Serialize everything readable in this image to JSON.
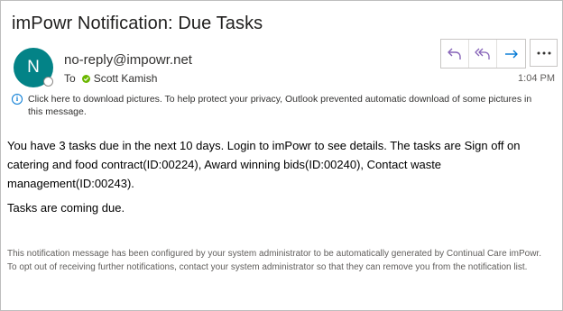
{
  "email": {
    "subject": "imPowr Notification: Due Tasks",
    "avatar_initial": "N",
    "sender": "no-reply@impowr.net",
    "to_label": "To",
    "recipient": "Scott Kamish",
    "time": "1:04 PM",
    "info_bar": "Click here to download pictures. To help protect your privacy, Outlook prevented automatic download of some pictures in this message.",
    "body_paragraph": "You have 3 tasks due in the next 10 days. Login to imPowr to see details. The tasks are Sign off on catering and food contract(ID:00224), Award winning bids(ID:00240), Contact waste management(ID:00243).",
    "body_note": "Tasks are coming due.",
    "footer_line1": "This notification message has been configured by your system administrator to be automatically generated by Continual Care imPowr.",
    "footer_line2": "To opt out of receiving further notifications, contact your system administrator so that they can remove you from the notification list."
  },
  "actions": [
    {
      "icon": "reply-icon"
    },
    {
      "icon": "reply-all-icon"
    },
    {
      "icon": "forward-icon"
    },
    {
      "icon": "more-actions-icon"
    }
  ],
  "colors": {
    "avatar": "#038387",
    "accent_purple": "#8764b8",
    "accent_blue": "#0078d4",
    "presence_green": "#6bb700"
  }
}
